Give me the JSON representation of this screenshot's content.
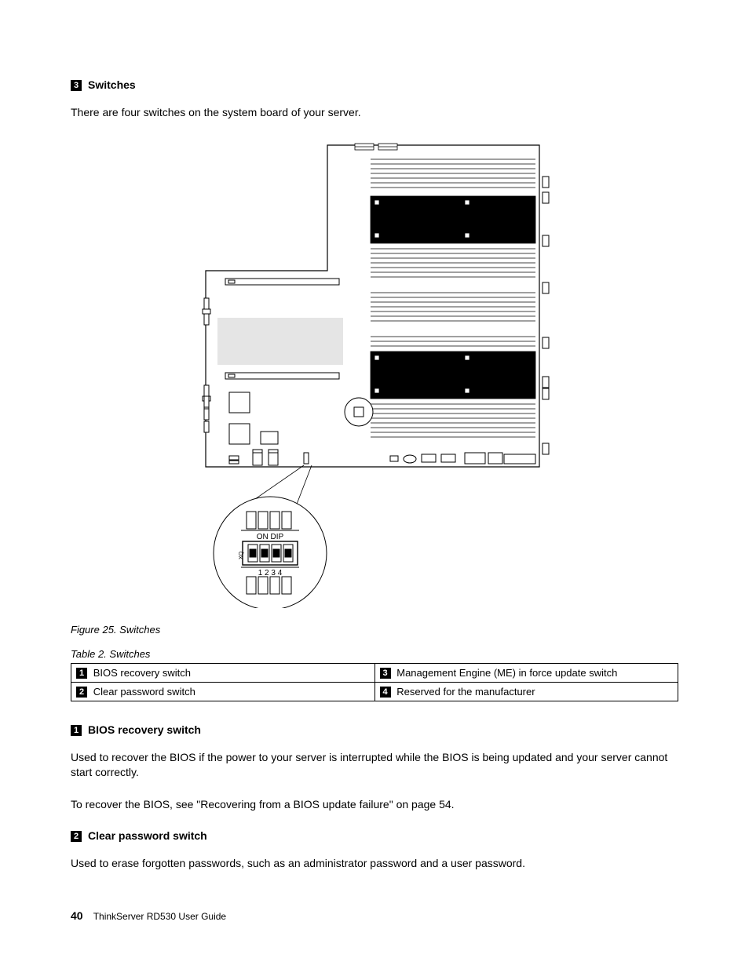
{
  "section_switches": {
    "callout": "3",
    "title": "Switches",
    "intro": "There are four switches on the system board of your server."
  },
  "figure": {
    "number": "Figure 25.",
    "title": "Switches",
    "dip_label_top": "ON DIP",
    "dip_nums": "1   2   3   4"
  },
  "table": {
    "caption_number": "Table 2.",
    "caption_title": "Switches",
    "rows": [
      {
        "left_num": "1",
        "left_text": "BIOS recovery switch",
        "right_num": "3",
        "right_text": "Management Engine (ME) in force update switch"
      },
      {
        "left_num": "2",
        "left_text": "Clear password switch",
        "right_num": "4",
        "right_text": "Reserved for the manufacturer"
      }
    ]
  },
  "section_bios": {
    "callout": "1",
    "title": "BIOS recovery switch",
    "p1": "Used to recover the BIOS if the power to your server is interrupted while the BIOS is being updated and your server cannot start correctly.",
    "p2": "To recover the BIOS, see \"Recovering from a BIOS update failure\" on page 54."
  },
  "section_clear": {
    "callout": "2",
    "title": "Clear password switch",
    "p1": "Used to erase forgotten passwords, such as an administrator password and a user password."
  },
  "footer": {
    "page": "40",
    "doc": "ThinkServer RD530 User Guide"
  }
}
